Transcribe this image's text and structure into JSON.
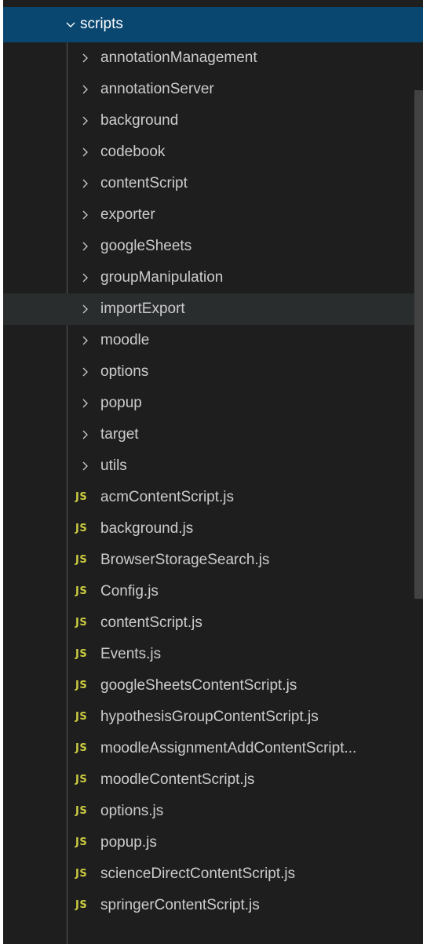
{
  "colors": {
    "background": "#1e1e1e",
    "selected_row": "#094771",
    "hover_row": "#2a2d2e",
    "text": "#cccccc",
    "js_badge": "#cbcb41",
    "scrollbar": "#424242"
  },
  "root_folder": {
    "label": "scripts",
    "icon": "chevron-down-icon"
  },
  "folders": [
    {
      "label": "annotationManagement",
      "icon": "chevron-right-icon"
    },
    {
      "label": "annotationServer",
      "icon": "chevron-right-icon"
    },
    {
      "label": "background",
      "icon": "chevron-right-icon"
    },
    {
      "label": "codebook",
      "icon": "chevron-right-icon"
    },
    {
      "label": "contentScript",
      "icon": "chevron-right-icon"
    },
    {
      "label": "exporter",
      "icon": "chevron-right-icon"
    },
    {
      "label": "googleSheets",
      "icon": "chevron-right-icon"
    },
    {
      "label": "groupManipulation",
      "icon": "chevron-right-icon"
    },
    {
      "label": "importExport",
      "icon": "chevron-right-icon"
    },
    {
      "label": "moodle",
      "icon": "chevron-right-icon"
    },
    {
      "label": "options",
      "icon": "chevron-right-icon"
    },
    {
      "label": "popup",
      "icon": "chevron-right-icon"
    },
    {
      "label": "target",
      "icon": "chevron-right-icon"
    },
    {
      "label": "utils",
      "icon": "chevron-right-icon"
    }
  ],
  "file_badge": "JS",
  "files": [
    {
      "label": "acmContentScript.js"
    },
    {
      "label": "background.js"
    },
    {
      "label": "BrowserStorageSearch.js"
    },
    {
      "label": "Config.js"
    },
    {
      "label": "contentScript.js"
    },
    {
      "label": "Events.js"
    },
    {
      "label": "googleSheetsContentScript.js"
    },
    {
      "label": "hypothesisGroupContentScript.js"
    },
    {
      "label": "moodleAssignmentAddContentScript..."
    },
    {
      "label": "moodleContentScript.js"
    },
    {
      "label": "options.js"
    },
    {
      "label": "popup.js"
    },
    {
      "label": "scienceDirectContentScript.js"
    },
    {
      "label": "springerContentScript.js"
    }
  ]
}
